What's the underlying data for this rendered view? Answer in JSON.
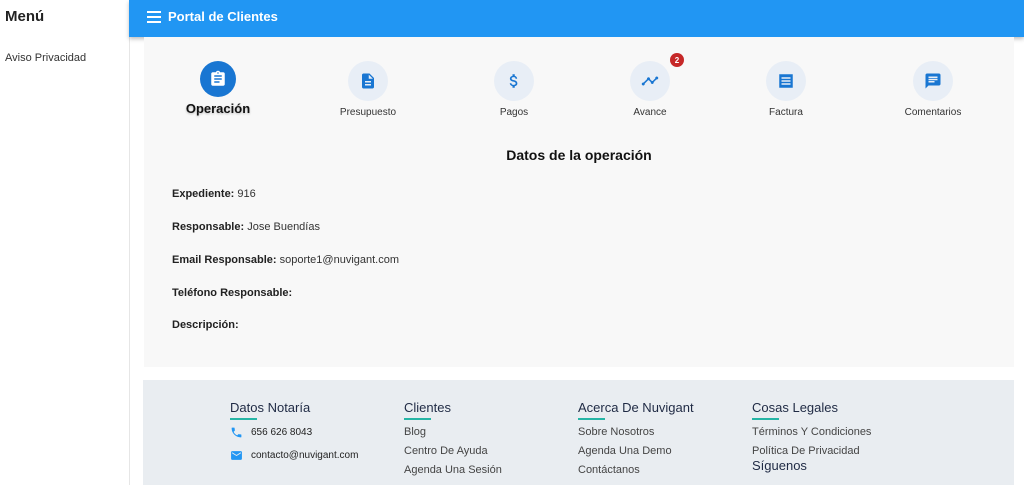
{
  "sidebar": {
    "title": "Menú",
    "items": [
      {
        "label": "Aviso Privacidad"
      }
    ]
  },
  "appbar": {
    "title": "Portal de Clientes"
  },
  "steps": [
    {
      "label": "Operación",
      "icon": "clipboard-icon",
      "active": true
    },
    {
      "label": "Presupuesto",
      "icon": "document-icon"
    },
    {
      "label": "Pagos",
      "icon": "dollar-icon"
    },
    {
      "label": "Avance",
      "icon": "trending-icon",
      "badge": "2"
    },
    {
      "label": "Factura",
      "icon": "receipt-icon"
    },
    {
      "label": "Comentarios",
      "icon": "comment-icon"
    }
  ],
  "operation": {
    "title": "Datos de la operación",
    "fields": [
      {
        "label": "Expediente:",
        "value": "916"
      },
      {
        "label": "Responsable:",
        "value": "Jose Buendías"
      },
      {
        "label": "Email Responsable:",
        "value": "soporte1@nuvigant.com"
      },
      {
        "label": "Teléfono Responsable:",
        "value": ""
      },
      {
        "label": "Descripción:",
        "value": ""
      }
    ]
  },
  "footer": {
    "notaria": {
      "heading": "Datos Notaría",
      "phone": "656 626 8043",
      "email": "contacto@nuvigant.com"
    },
    "clientes": {
      "heading": "Clientes",
      "links": [
        "Blog",
        "Centro De Ayuda",
        "Agenda Una Sesión"
      ]
    },
    "acerca": {
      "heading": "Acerca De Nuvigant",
      "links": [
        "Sobre Nosotros",
        "Agenda Una Demo",
        "Contáctanos"
      ]
    },
    "legales": {
      "heading": "Cosas Legales",
      "links": [
        "Términos Y Condiciones",
        "Política De Privacidad"
      ],
      "subheading": "Síguenos"
    }
  },
  "colors": {
    "primary": "#2196f3",
    "active_step": "#1976d2",
    "step_bg": "#e8eef6",
    "badge": "#c62828",
    "accent_underline": "#26b5a6",
    "footer_bg": "#e9edf1"
  }
}
